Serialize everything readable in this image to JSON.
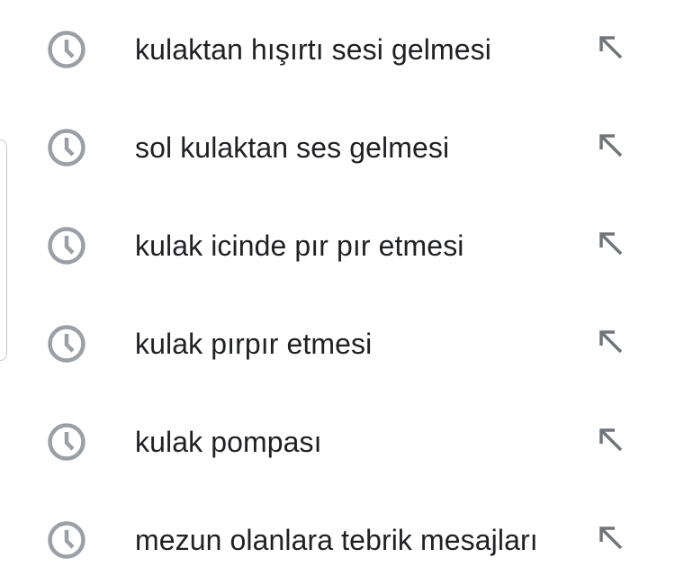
{
  "colors": {
    "text": "#202124",
    "icon": "#9aa0a6"
  },
  "suggestions": [
    {
      "text": "kulaktan hışırtı sesi gelmesi",
      "icon": "history-clock-icon",
      "action_icon": "fill-query-arrow-icon"
    },
    {
      "text": "sol kulaktan ses gelmesi",
      "icon": "history-clock-icon",
      "action_icon": "fill-query-arrow-icon"
    },
    {
      "text": "kulak icinde pır pır etmesi",
      "icon": "history-clock-icon",
      "action_icon": "fill-query-arrow-icon"
    },
    {
      "text": "kulak pırpır etmesi",
      "icon": "history-clock-icon",
      "action_icon": "fill-query-arrow-icon"
    },
    {
      "text": "kulak pompası",
      "icon": "history-clock-icon",
      "action_icon": "fill-query-arrow-icon"
    },
    {
      "text": "mezun olanlara tebrik mesajları",
      "icon": "history-clock-icon",
      "action_icon": "fill-query-arrow-icon"
    }
  ]
}
